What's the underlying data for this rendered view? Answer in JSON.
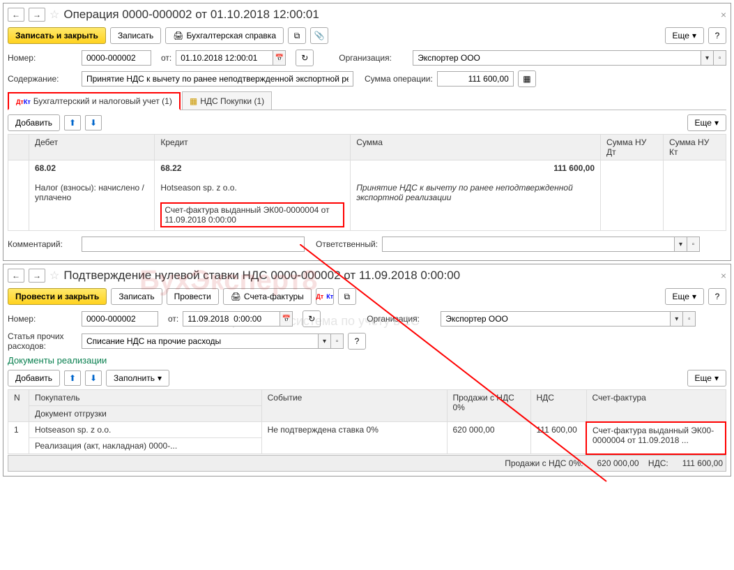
{
  "win1": {
    "title": "Операция 0000-000002 от 01.10.2018 12:00:01",
    "btn_primary": "Записать и закрыть",
    "btn_write": "Записать",
    "btn_print": "Бухгалтерская справка",
    "btn_more": "Еще",
    "lbl_number": "Номер:",
    "val_number": "0000-000002",
    "lbl_from": "от:",
    "val_date": "01.10.2018 12:00:01",
    "lbl_org": "Организация:",
    "val_org": "Экспортер ООО",
    "lbl_content": "Содержание:",
    "val_content": "Принятие НДС к вычету по ранее неподтвержденной экспортной ре",
    "lbl_sum": "Сумма операции:",
    "val_sum": "111 600,00",
    "tab1": "Бухгалтерский и налоговый учет (1)",
    "tab2": "НДС Покупки (1)",
    "btn_add": "Добавить",
    "cols": {
      "debit": "Дебет",
      "credit": "Кредит",
      "sum": "Сумма",
      "sumdt": "Сумма НУ Дт",
      "sumkt": "Сумма НУ Кт"
    },
    "row": {
      "debit1": "68.02",
      "debit2": "Налог (взносы): начислено / уплачено",
      "credit1": "68.22",
      "credit2": "Hotseason sp. z o.o.",
      "credit3": "Счет-фактура выданный ЭК00-0000004 от 11.09.2018 0:00:00",
      "sum": "111 600,00",
      "desc": "Принятие НДС к вычету по ранее неподтвержденной экспортной реализации"
    },
    "lbl_comment": "Комментарий:",
    "lbl_resp": "Ответственный:"
  },
  "win2": {
    "title": "Подтверждение нулевой ставки НДС 0000-000002 от 11.09.2018 0:00:00",
    "btn_primary": "Провести и закрыть",
    "btn_write": "Записать",
    "btn_post": "Провести",
    "btn_print": "Счета-фактуры",
    "btn_more": "Еще",
    "lbl_number": "Номер:",
    "val_number": "0000-000002",
    "lbl_from": "от:",
    "val_date": "11.09.2018  0:00:00",
    "lbl_org": "Организация:",
    "val_org": "Экспортер ООО",
    "lbl_article": "Статья прочих расходов:",
    "val_article": "Списание НДС на прочие расходы",
    "link": "Документы реализации",
    "btn_add": "Добавить",
    "btn_fill": "Заполнить",
    "cols": {
      "n": "N",
      "buyer": "Покупатель",
      "doc": "Документ отгрузки",
      "event": "Событие",
      "sales": "Продажи с НДС 0%",
      "nds": "НДС",
      "sf": "Счет-фактура"
    },
    "row": {
      "n": "1",
      "buyer": "Hotseason sp. z o.o.",
      "doc": "Реализация (акт, накладная) 0000-...",
      "event": "Не подтверждена ставка 0%",
      "sales": "620 000,00",
      "nds": "111 600,00",
      "sf": "Счет-фактура выданный ЭК00-0000004 от 11.09.2018 ..."
    },
    "footer_lbl1": "Продажи с НДС 0%:",
    "footer_val1": "620 000,00",
    "footer_lbl2": "НДС:",
    "footer_val2": "111 600,00"
  }
}
